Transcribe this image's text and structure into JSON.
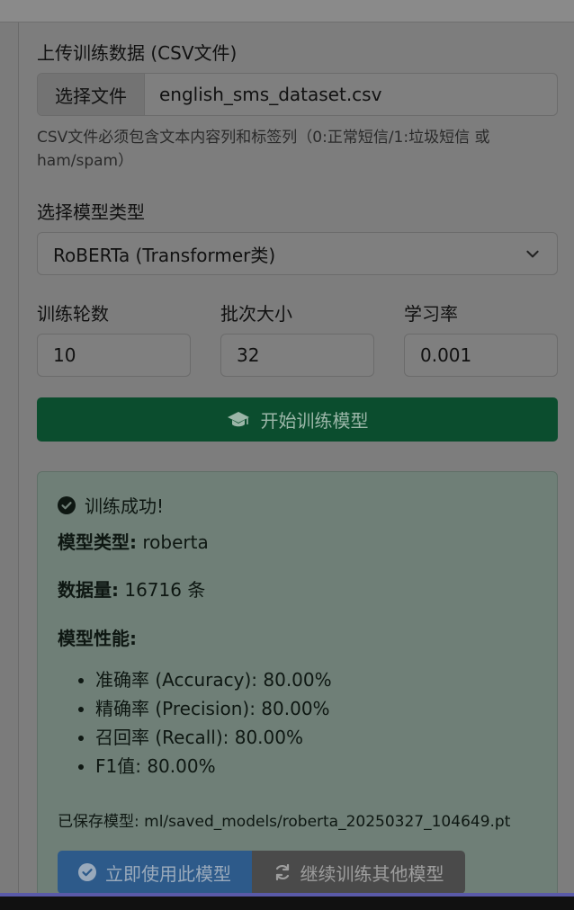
{
  "form": {
    "upload_label": "上传训练数据 (CSV文件)",
    "file_button": "选择文件",
    "file_name": "english_sms_dataset.csv",
    "help_text": "CSV文件必须包含文本内容列和标签列（0:正常短信/1:垃圾短信 或 ham/spam）",
    "model_type_label": "选择模型类型",
    "model_type_value": "RoBERTa (Transformer类)",
    "epochs_label": "训练轮数",
    "epochs_value": "10",
    "batch_label": "批次大小",
    "batch_value": "32",
    "lr_label": "学习率",
    "lr_value": "0.001",
    "train_button": "开始训练模型"
  },
  "result": {
    "success_text": "训练成功!",
    "model_type_key": "模型类型:",
    "model_type_val": "roberta",
    "data_key": "数据量:",
    "data_val": "16716 条",
    "perf_title": "模型性能:",
    "metrics": [
      "准确率 (Accuracy): 80.00%",
      "精确率 (Precision): 80.00%",
      "召回率 (Recall): 80.00%",
      "F1值: 80.00%"
    ],
    "saved_key": "已保存模型:",
    "saved_path": "ml/saved_models/roberta_20250327_104649.pt",
    "use_button": "立即使用此模型",
    "continue_button": "继续训练其他模型"
  },
  "colors": {
    "train_button_bg": "#0b4d2e",
    "result_bg": "#6f7f77",
    "use_button_bg": "#2d5a8a",
    "continue_button_bg": "#4a4a4a"
  },
  "icons": {
    "train_button": "graduation-cap-icon",
    "success": "check-circle-icon",
    "use_button": "check-circle-icon",
    "continue_button": "sync-icon",
    "select": "chevron-down-icon"
  }
}
